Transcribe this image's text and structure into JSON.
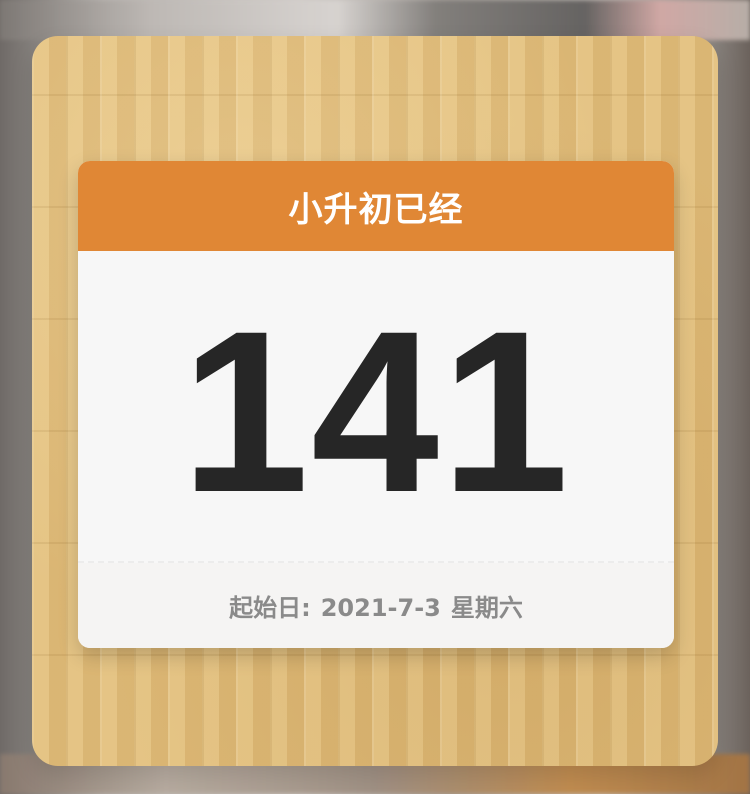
{
  "widget": {
    "title": "小升初已经",
    "count": "141",
    "footer": {
      "label": "起始日:",
      "date": "2021-7-3",
      "weekday": "星期六"
    }
  },
  "colors": {
    "accent": "#e08735",
    "card_bg": "#f7f7f7",
    "number": "#262626",
    "footer_text": "#8a8a8a"
  }
}
